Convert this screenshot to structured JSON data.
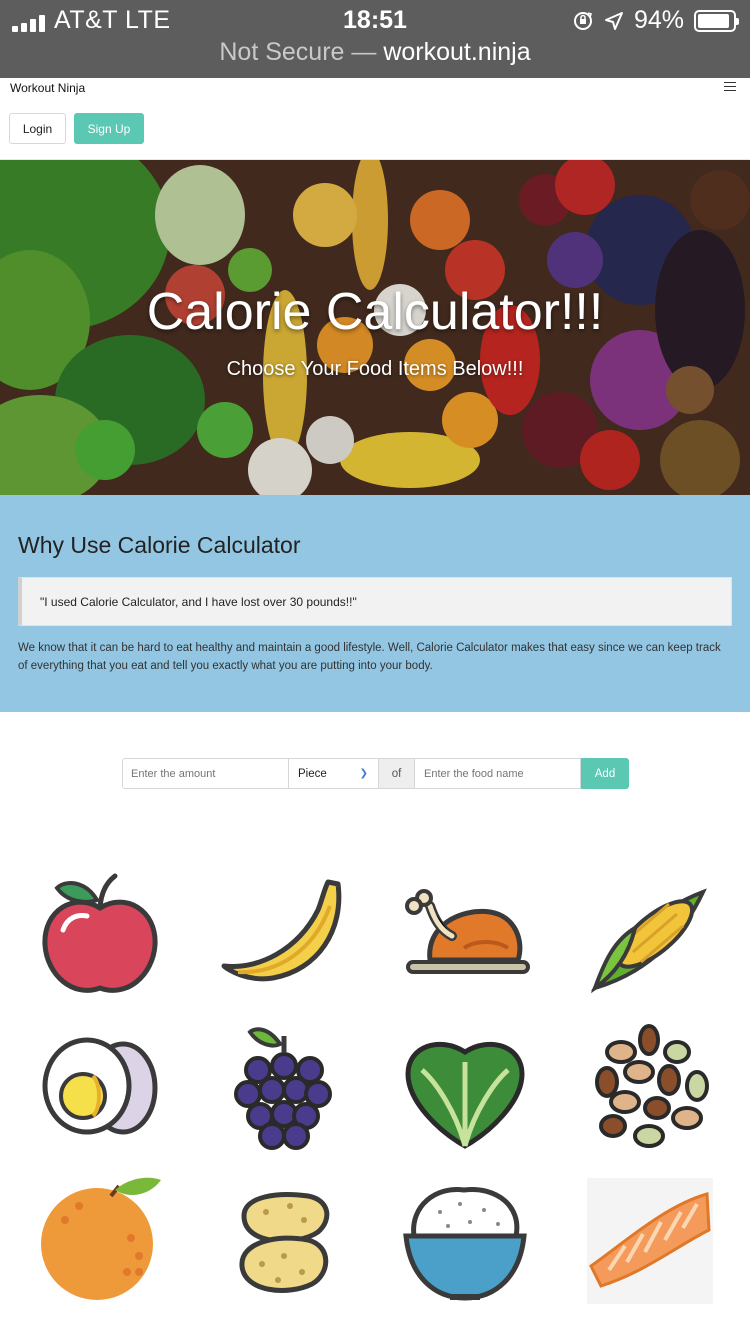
{
  "status_bar": {
    "carrier": "AT&T  LTE",
    "time": "18:51",
    "battery": "94%",
    "battery_level": 0.94
  },
  "address_bar": {
    "security": "Not Secure —",
    "domain": "workout.ninja"
  },
  "nav": {
    "brand": "Workout Ninja",
    "login": "Login",
    "signup": "Sign Up"
  },
  "hero": {
    "title": "Calorie Calculator!!!",
    "subtitle": "Choose Your Food Items Below!!!"
  },
  "why": {
    "heading": "Why Use Calorie Calculator",
    "quote": "\"I used Calorie Calculator, and I have lost over 30 pounds!!\"",
    "body": "We know that it can be hard to eat healthy and maintain a good lifestyle. Well, Calorie Calculator makes that easy since we can keep track of everything that you eat and tell you exactly what you are putting into your body."
  },
  "form": {
    "amount_placeholder": "Enter the amount",
    "unit_selected": "Piece",
    "of_label": "of",
    "food_placeholder": "Enter the food name",
    "add_label": "Add"
  },
  "foods": [
    "apple-icon",
    "banana-icon",
    "chicken-icon",
    "corn-icon",
    "egg-icon",
    "grapes-icon",
    "spinach-icon",
    "nuts-icon",
    "orange-icon",
    "potato-icon",
    "rice-icon",
    "salmon-icon"
  ],
  "colors": {
    "accent": "#5bc8b4",
    "why_bg": "#92c6e2",
    "status_bg": "#5d5d5d"
  }
}
